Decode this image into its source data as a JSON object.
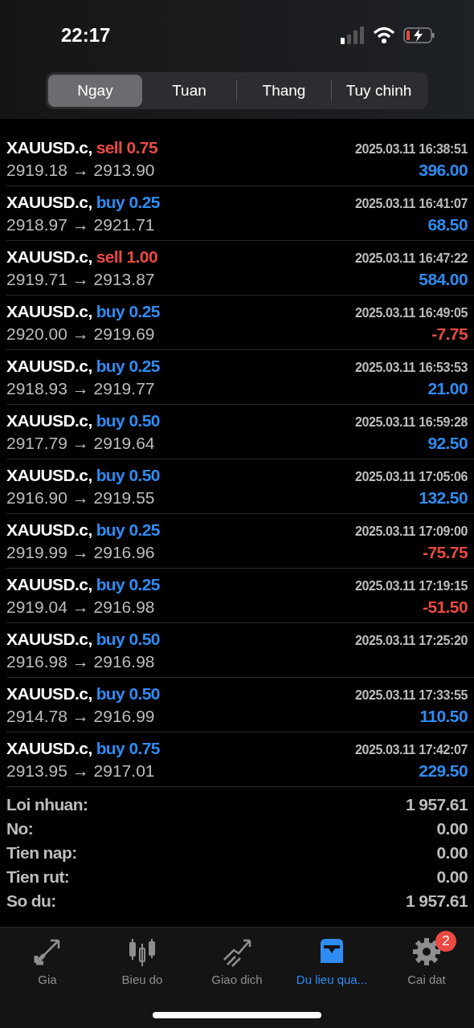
{
  "status_bar": {
    "time": "22:17"
  },
  "segments": [
    {
      "label": "Ngay",
      "selected": true
    },
    {
      "label": "Tuan",
      "selected": false
    },
    {
      "label": "Thang",
      "selected": false
    },
    {
      "label": "Tuy chinh",
      "selected": false
    }
  ],
  "trades": [
    {
      "symbol": "XAUUSD.c,",
      "order": {
        "text": "sell 0.75",
        "color": "#ec4a43"
      },
      "time": "2025.03.11 16:38:51",
      "prices": "2919.18 → 2913.90",
      "profit": {
        "text": "396.00",
        "color": "#2f8cf2"
      }
    },
    {
      "symbol": "XAUUSD.c,",
      "order": {
        "text": "buy 0.25",
        "color": "#2f8cf2"
      },
      "time": "2025.03.11 16:41:07",
      "prices": "2918.97 → 2921.71",
      "profit": {
        "text": "68.50",
        "color": "#2f8cf2"
      }
    },
    {
      "symbol": "XAUUSD.c,",
      "order": {
        "text": "sell 1.00",
        "color": "#ec4a43"
      },
      "time": "2025.03.11 16:47:22",
      "prices": "2919.71 → 2913.87",
      "profit": {
        "text": "584.00",
        "color": "#2f8cf2"
      }
    },
    {
      "symbol": "XAUUSD.c,",
      "order": {
        "text": "buy 0.25",
        "color": "#2f8cf2"
      },
      "time": "2025.03.11 16:49:05",
      "prices": "2920.00 → 2919.69",
      "profit": {
        "text": "-7.75",
        "color": "#ec4a43"
      }
    },
    {
      "symbol": "XAUUSD.c,",
      "order": {
        "text": "buy 0.25",
        "color": "#2f8cf2"
      },
      "time": "2025.03.11 16:53:53",
      "prices": "2918.93 → 2919.77",
      "profit": {
        "text": "21.00",
        "color": "#2f8cf2"
      }
    },
    {
      "symbol": "XAUUSD.c,",
      "order": {
        "text": "buy 0.50",
        "color": "#2f8cf2"
      },
      "time": "2025.03.11 16:59:28",
      "prices": "2917.79 → 2919.64",
      "profit": {
        "text": "92.50",
        "color": "#2f8cf2"
      }
    },
    {
      "symbol": "XAUUSD.c,",
      "order": {
        "text": "buy 0.50",
        "color": "#2f8cf2"
      },
      "time": "2025.03.11 17:05:06",
      "prices": "2916.90 → 2919.55",
      "profit": {
        "text": "132.50",
        "color": "#2f8cf2"
      }
    },
    {
      "symbol": "XAUUSD.c,",
      "order": {
        "text": "buy 0.25",
        "color": "#2f8cf2"
      },
      "time": "2025.03.11 17:09:00",
      "prices": "2919.99 → 2916.96",
      "profit": {
        "text": "-75.75",
        "color": "#ec4a43"
      }
    },
    {
      "symbol": "XAUUSD.c,",
      "order": {
        "text": "buy 0.25",
        "color": "#2f8cf2"
      },
      "time": "2025.03.11 17:19:15",
      "prices": "2919.04 → 2916.98",
      "profit": {
        "text": "-51.50",
        "color": "#ec4a43"
      }
    },
    {
      "symbol": "XAUUSD.c,",
      "order": {
        "text": "buy 0.50",
        "color": "#2f8cf2"
      },
      "time": "2025.03.11 17:25:20",
      "prices": "2916.98 → 2916.98"
    },
    {
      "symbol": "XAUUSD.c,",
      "order": {
        "text": "buy 0.50",
        "color": "#2f8cf2"
      },
      "time": "2025.03.11 17:33:55",
      "prices": "2914.78 → 2916.99",
      "profit": {
        "text": "110.50",
        "color": "#2f8cf2"
      }
    },
    {
      "symbol": "XAUUSD.c,",
      "order": {
        "text": "buy 0.75",
        "color": "#2f8cf2"
      },
      "time": "2025.03.11 17:42:07",
      "prices": "2913.95 → 2917.01",
      "profit": {
        "text": "229.50",
        "color": "#2f8cf2"
      }
    }
  ],
  "summary": [
    {
      "label": "Loi nhuan:",
      "value": "1 957.61"
    },
    {
      "label": "No:",
      "value": "0.00"
    },
    {
      "label": "Tien nap:",
      "value": "0.00"
    },
    {
      "label": "Tien rut:",
      "value": "0.00"
    },
    {
      "label": "So du:",
      "value": "1 957.61"
    }
  ],
  "tab_bar": [
    {
      "kind": "quotes",
      "label": "Gia",
      "selected": false
    },
    {
      "kind": "chart",
      "label": "Bieu do",
      "selected": false
    },
    {
      "kind": "trade",
      "label": "Giao dich",
      "selected": false
    },
    {
      "kind": "history",
      "label": "Du lieu qua...",
      "selected": true
    },
    {
      "kind": "settings",
      "label": "Cai dat",
      "selected": false,
      "badge": "2"
    }
  ]
}
